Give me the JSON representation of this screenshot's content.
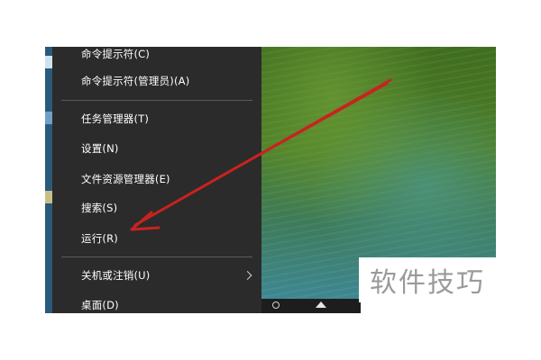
{
  "menu": {
    "items": [
      {
        "label": "命令提示符(C)",
        "has_submenu": false
      },
      {
        "label": "命令提示符(管理员)(A)",
        "has_submenu": false
      },
      {
        "label": "任务管理器(T)",
        "has_submenu": false
      },
      {
        "label": "设置(N)",
        "has_submenu": false
      },
      {
        "label": "文件资源管理器(E)",
        "has_submenu": false
      },
      {
        "label": "搜索(S)",
        "has_submenu": false
      },
      {
        "label": "运行(R)",
        "has_submenu": false
      },
      {
        "label": "关机或注销(U)",
        "has_submenu": true
      },
      {
        "label": "桌面(D)",
        "has_submenu": false
      }
    ]
  },
  "watermark": {
    "text": "软件技巧"
  },
  "annotation": {
    "color": "#c8231f",
    "points_to": "运行(R)"
  },
  "colors": {
    "menu_bg": "#2b2b2b",
    "menu_text": "#ffffff",
    "separator": "#5a5a5a"
  }
}
